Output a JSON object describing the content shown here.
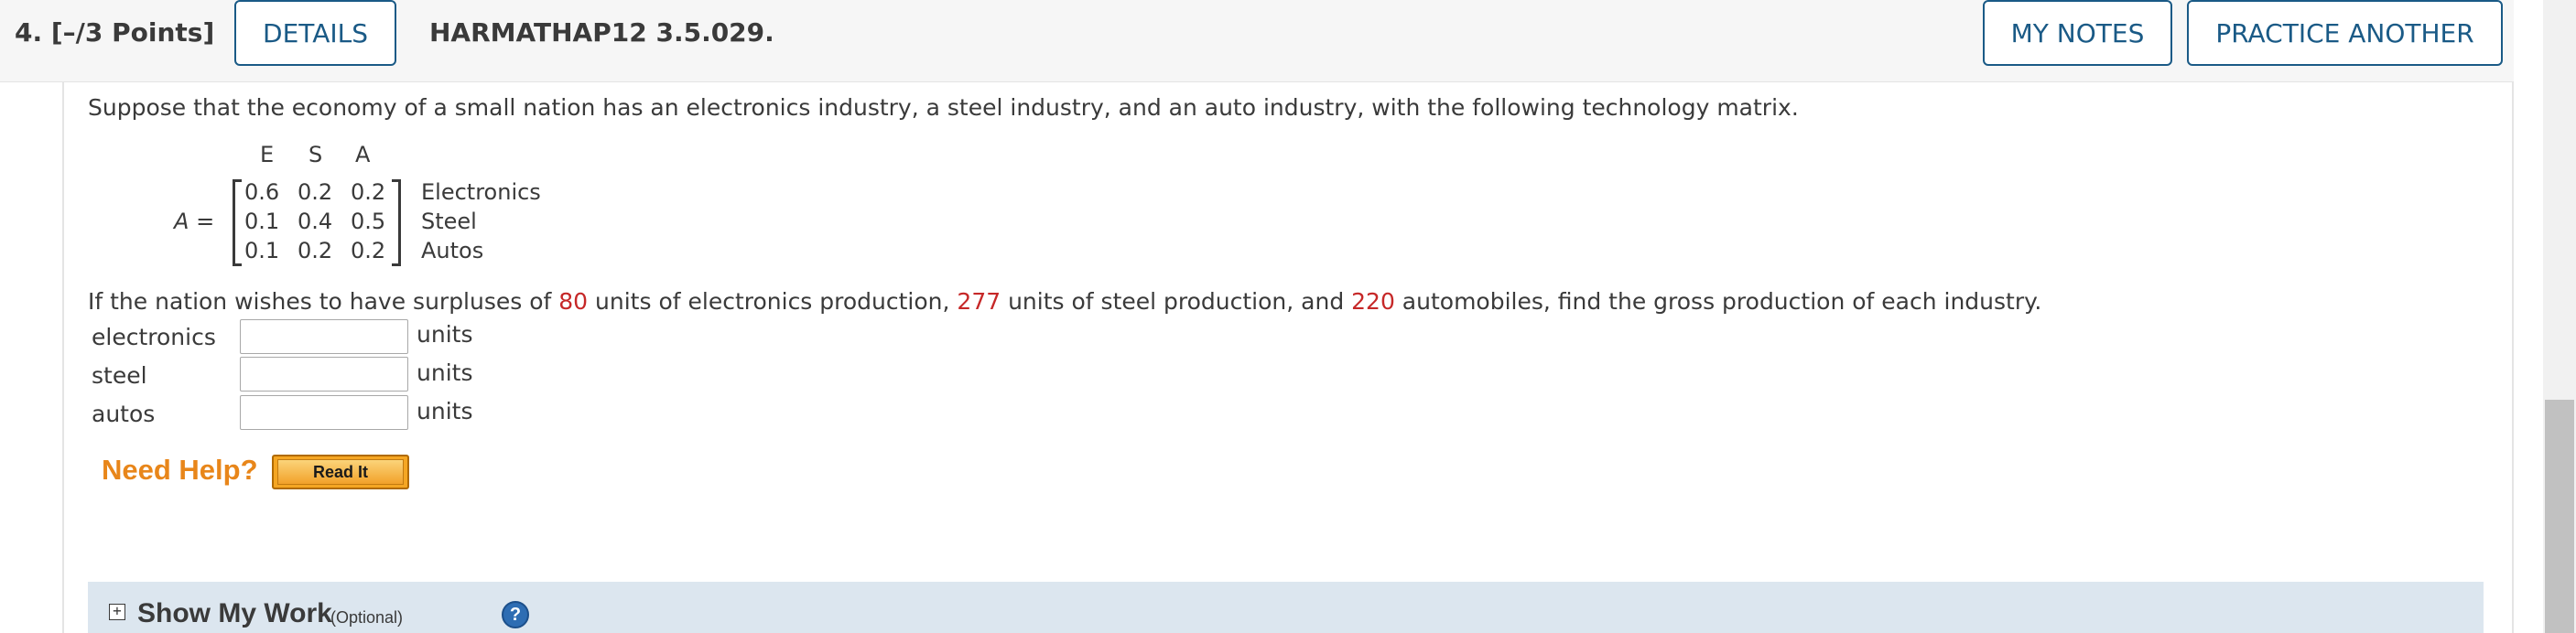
{
  "header": {
    "question_number": "4.",
    "points": "[–/3 Points]",
    "details_label": "DETAILS",
    "question_code": "HARMATHAP12 3.5.029.",
    "my_notes_label": "MY NOTES",
    "practice_label": "PRACTICE ANOTHER"
  },
  "problem": {
    "intro": "Suppose that the economy of a small nation has an electronics industry, a steel industry, and an auto industry, with the following technology matrix.",
    "matrix": {
      "name": "A",
      "equals": "=",
      "column_labels": [
        "E",
        "S",
        "A"
      ],
      "rows": [
        {
          "values": [
            "0.6",
            "0.2",
            "0.2"
          ],
          "label": "Electronics"
        },
        {
          "values": [
            "0.1",
            "0.4",
            "0.5"
          ],
          "label": "Steel"
        },
        {
          "values": [
            "0.1",
            "0.2",
            "0.2"
          ],
          "label": "Autos"
        }
      ]
    },
    "question": {
      "part1": "If the nation wishes to have surpluses of ",
      "v1": "80",
      "part2": " units of electronics production, ",
      "v2": "277",
      "part3": " units of steel production, and ",
      "v3": "220",
      "part4": " automobiles, find the gross production of each industry."
    },
    "fields": [
      {
        "label": "electronics",
        "value": "",
        "unit": "units"
      },
      {
        "label": "steel",
        "value": "",
        "unit": "units"
      },
      {
        "label": "autos",
        "value": "",
        "unit": "units"
      }
    ]
  },
  "help": {
    "need_help": "Need Help?",
    "read_it": "Read It"
  },
  "show_my_work": {
    "toggle": "+",
    "title": "Show My Work",
    "optional": "(Optional)",
    "help_icon": "?"
  },
  "colors": {
    "accent_blue": "#1a5a86",
    "surplus_red": "#c62828",
    "help_orange": "#e8861a",
    "show_work_bg": "#dce6ef"
  }
}
